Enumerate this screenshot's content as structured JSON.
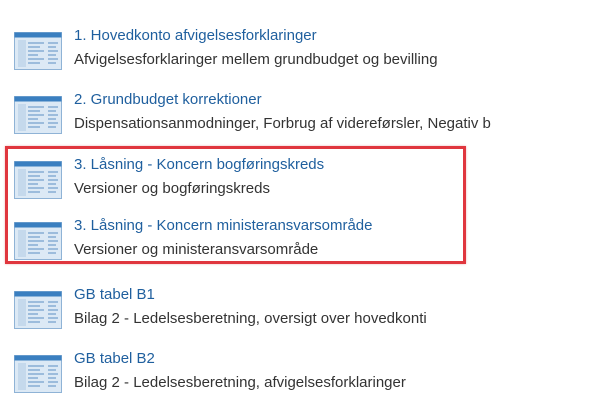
{
  "reports": [
    {
      "title": "1. Hovedkonto afvigelsesforklaringer",
      "description": "Afvigelsesforklaringer mellem grundbudget og bevilling",
      "icon": "report-document-icon"
    },
    {
      "title": "2. Grundbudget korrektioner",
      "description": "Dispensationsanmodninger, Forbrug af videreførsler, Negativ b",
      "icon": "report-document-icon"
    },
    {
      "title": "3. Låsning - Koncern bogføringskreds",
      "description": "Versioner og bogføringskreds",
      "icon": "report-document-icon"
    },
    {
      "title": "3. Låsning - Koncern ministeransvarsområde",
      "description": "Versioner og ministeransvarsområde",
      "icon": "report-document-icon"
    },
    {
      "title": "GB tabel B1",
      "description": "Bilag 2 - Ledelsesberetning, oversigt over hovedkonti",
      "icon": "report-document-icon"
    },
    {
      "title": "GB tabel B2",
      "description": "Bilag 2 - Ledelsesberetning, afvigelsesforklaringer",
      "icon": "report-document-icon"
    }
  ],
  "colors": {
    "link": "#1f5f9e",
    "text": "#333333",
    "highlight": "#e0363e",
    "icon_header": "#3a7fc0",
    "icon_body": "#dce9f5"
  }
}
